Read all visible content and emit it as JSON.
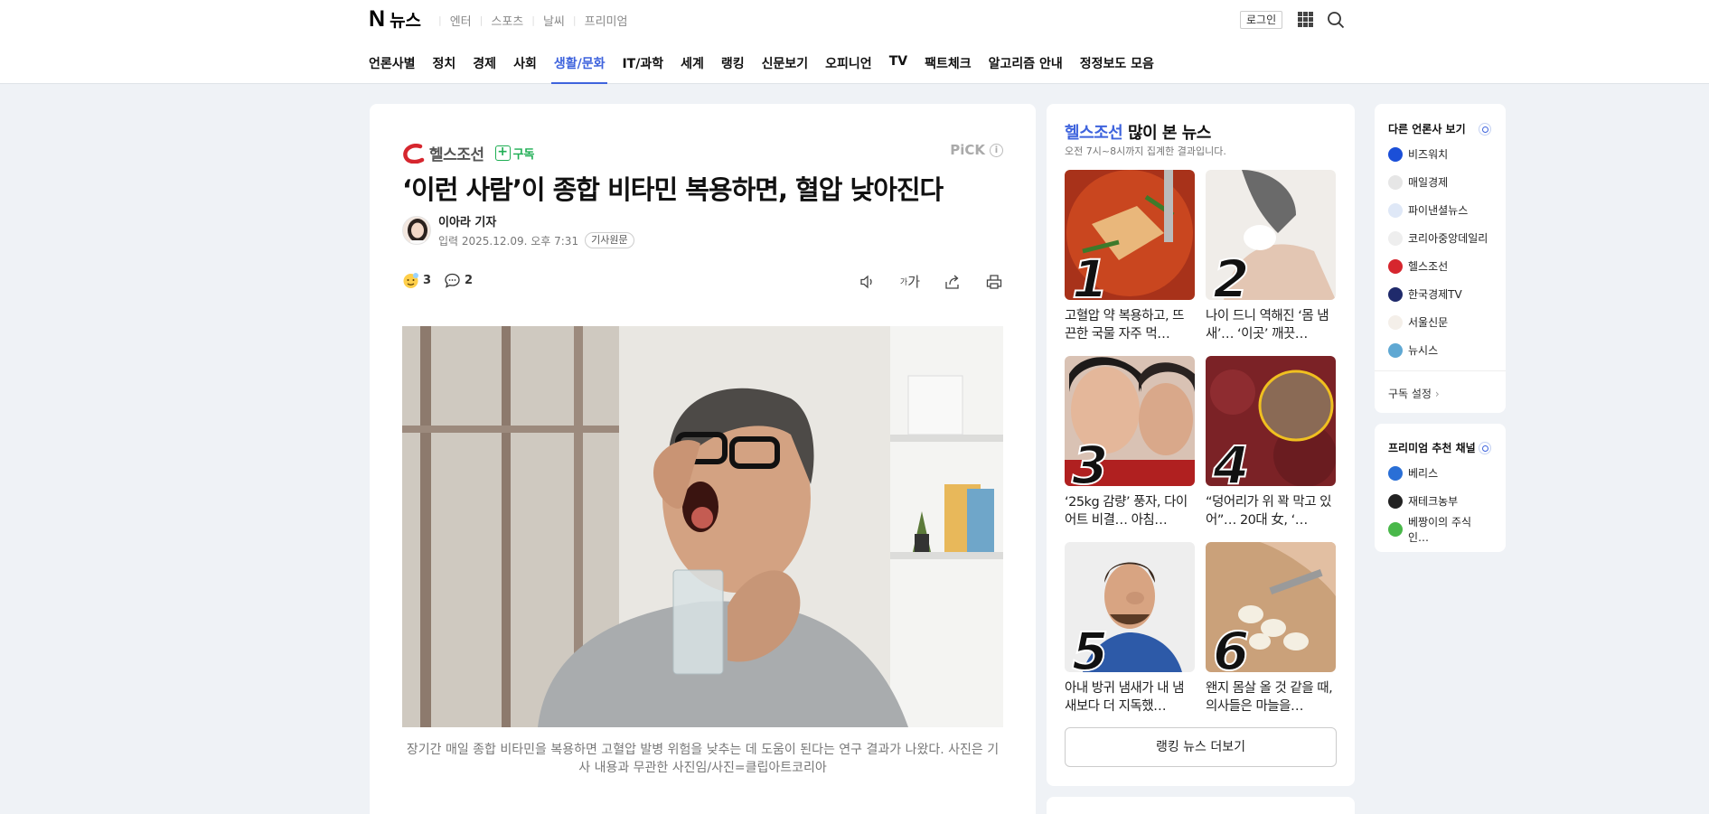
{
  "header": {
    "logo_mark": "N",
    "logo_text": "뉴스",
    "services": [
      "엔터",
      "스포츠",
      "날씨",
      "프리미엄"
    ],
    "login": "로그인"
  },
  "gnb": {
    "items": [
      "언론사별",
      "정치",
      "경제",
      "사회",
      "생활/문화",
      "IT/과학",
      "세계",
      "랭킹",
      "신문보기",
      "오피니언",
      "TV",
      "팩트체크",
      "알고리즘 안내",
      "정정보도 모음"
    ],
    "active": "생활/문화"
  },
  "article": {
    "press": "헬스조선",
    "subscribe": "구독",
    "pick": "PiCK",
    "pick_info": "i",
    "title": "‘이런 사람’이 종합 비타민 복용하면, 혈압 낮아진다",
    "reporter": "이아라 기자",
    "date": "입력 2025.12.09. 오후 7:31",
    "original_link": "기사원문",
    "reaction_count": "3",
    "comment_count": "2",
    "font_size_label": "가",
    "font_size_small": "가",
    "caption": "장기간 매일 종합 비타민을 복용하면 고혈압 발병 위험을 낮추는 데 도움이 된다는 연구 결과가 나왔다. 사진은 기사 내용과 무관한 사진임/사진=클립아트코리아"
  },
  "ranking": {
    "press": "헬스조선",
    "title_suffix": "많이 본 뉴스",
    "subtitle": "오전 7시~8시까지 집계한 결과입니다.",
    "items": [
      {
        "rank": "1",
        "title": "고혈압 약 복용하고, 뜨끈한 국물 자주 먹…"
      },
      {
        "rank": "2",
        "title": "나이 드니 역해진 ‘몸 냄새’… ‘이곳’ 깨끗…"
      },
      {
        "rank": "3",
        "title": "‘25kg 감량’ 풍자, 다이어트 비결… 아침…"
      },
      {
        "rank": "4",
        "title": "“덩어리가 위 꽉 막고 있어”… 20대 女, ‘…"
      },
      {
        "rank": "5",
        "title": "아내 방귀 냄새가 내 냄새보다 더 지독했…"
      },
      {
        "rank": "6",
        "title": "왠지 몸살 올 것 같을 때, 의사들은 마늘을…"
      }
    ],
    "more": "랭킹 뉴스 더보기"
  },
  "other_press": {
    "title": "다른 언론사 보기",
    "items": [
      {
        "name": "비즈워치",
        "color": "#1b4fd8"
      },
      {
        "name": "매일경제",
        "color": "#e6e6e6"
      },
      {
        "name": "파이낸셜뉴스",
        "color": "#dfe8f7"
      },
      {
        "name": "코리아중앙데일리",
        "color": "#eeeeee"
      },
      {
        "name": "헬스조선",
        "color": "#d6262e"
      },
      {
        "name": "한국경제TV",
        "color": "#1f2a6b"
      },
      {
        "name": "서울신문",
        "color": "#f4efe9"
      },
      {
        "name": "뉴시스",
        "color": "#5fa8d3"
      }
    ],
    "subscription_settings": "구독 설정"
  },
  "premium": {
    "title": "프리미엄 추천 채널",
    "items": [
      {
        "name": "베리스",
        "color": "#2a6fd6"
      },
      {
        "name": "재테크농부",
        "color": "#222222"
      },
      {
        "name": "베짱이의 주식 인…",
        "color": "#49b84a"
      }
    ]
  }
}
